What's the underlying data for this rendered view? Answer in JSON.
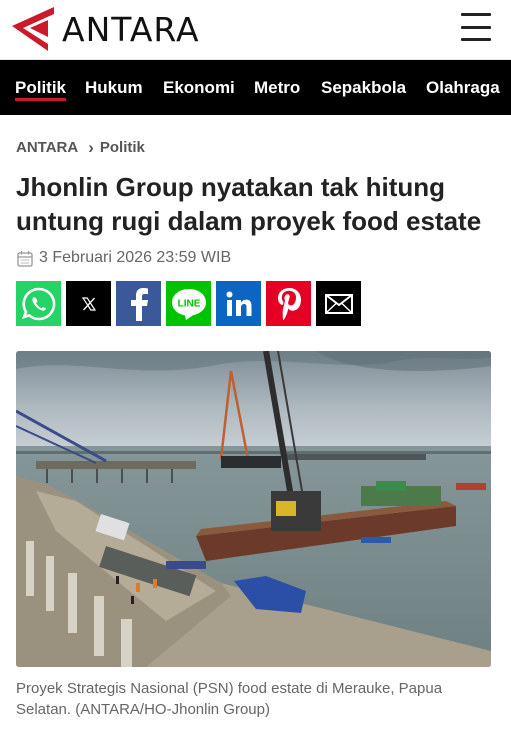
{
  "header": {
    "logo_text": "ANTARA",
    "menu_icon": "hamburger-menu-icon"
  },
  "nav": {
    "items": [
      {
        "label": "Politik",
        "active": true
      },
      {
        "label": "Hukum"
      },
      {
        "label": "Ekonomi"
      },
      {
        "label": "Metro"
      },
      {
        "label": "Sepakbola"
      },
      {
        "label": "Olahraga"
      }
    ]
  },
  "breadcrumb": {
    "home": "ANTARA",
    "category": "Politik"
  },
  "article": {
    "title": "Jhonlin Group nyatakan tak hitung untung rugi dalam proyek food estate",
    "date": "3 Februari 2026 23:59 WIB",
    "caption": "Proyek Strategis Nasional (PSN) food estate di Merauke, Papua Selatan. (ANTARA/HO-Jhonlin Group)"
  },
  "share": {
    "buttons": [
      {
        "icon": "whatsapp-icon",
        "color": "#25d366"
      },
      {
        "icon": "x-icon",
        "color": "#000000"
      },
      {
        "icon": "facebook-icon",
        "color": "#3b5998"
      },
      {
        "icon": "line-icon",
        "color": "#00c300"
      },
      {
        "icon": "linkedin-icon",
        "color": "#0a66c2"
      },
      {
        "icon": "pinterest-icon",
        "color": "#e60023"
      },
      {
        "icon": "email-icon",
        "color": "#000000"
      }
    ]
  },
  "colors": {
    "brand_red": "#c91b2b",
    "nav_bg": "#000000"
  }
}
